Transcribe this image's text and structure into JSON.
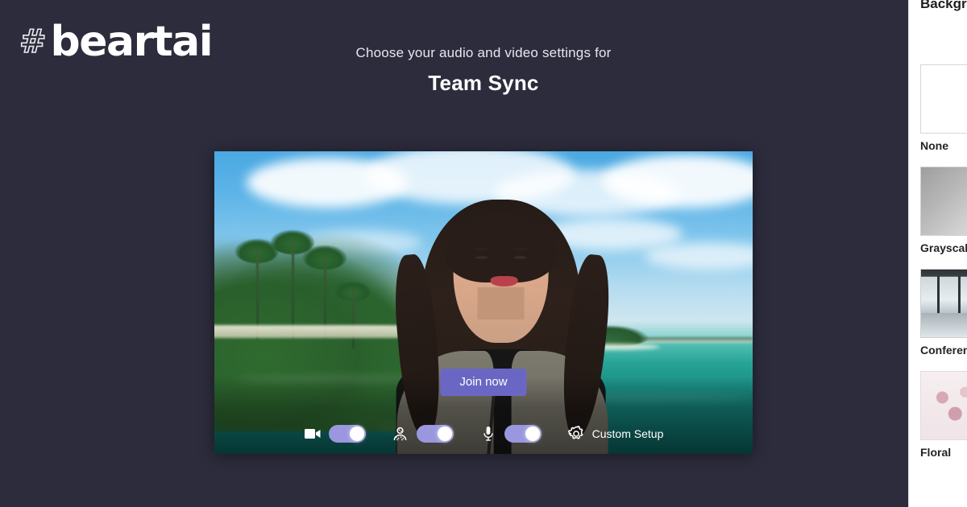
{
  "watermark": {
    "hash": "#",
    "word": "beartai"
  },
  "prejoin": {
    "heading": "Choose your audio and video settings for",
    "meeting_title": "Team Sync",
    "join_button": "Join now",
    "accent_color": "#6a67c4",
    "page_background": "#2d2c3d"
  },
  "controls": {
    "camera": {
      "icon": "camera-icon",
      "state": "on"
    },
    "background_effects": {
      "icon": "background-effects-icon",
      "state": "on"
    },
    "microphone": {
      "icon": "microphone-icon",
      "state": "on"
    },
    "custom_setup": {
      "icon": "gear-icon",
      "label": "Custom Setup"
    }
  },
  "background_panel": {
    "title": "Background settings",
    "items": [
      {
        "label": "None",
        "thumb": "none-thumb"
      },
      {
        "label": "Grayscale",
        "thumb": "gray-thumb"
      },
      {
        "label": "Conference room",
        "thumb": "office-thumb"
      },
      {
        "label": "Floral",
        "thumb": "floral-thumb"
      }
    ]
  },
  "video_preview": {
    "description": "Live camera preview with tropical island virtual background"
  }
}
